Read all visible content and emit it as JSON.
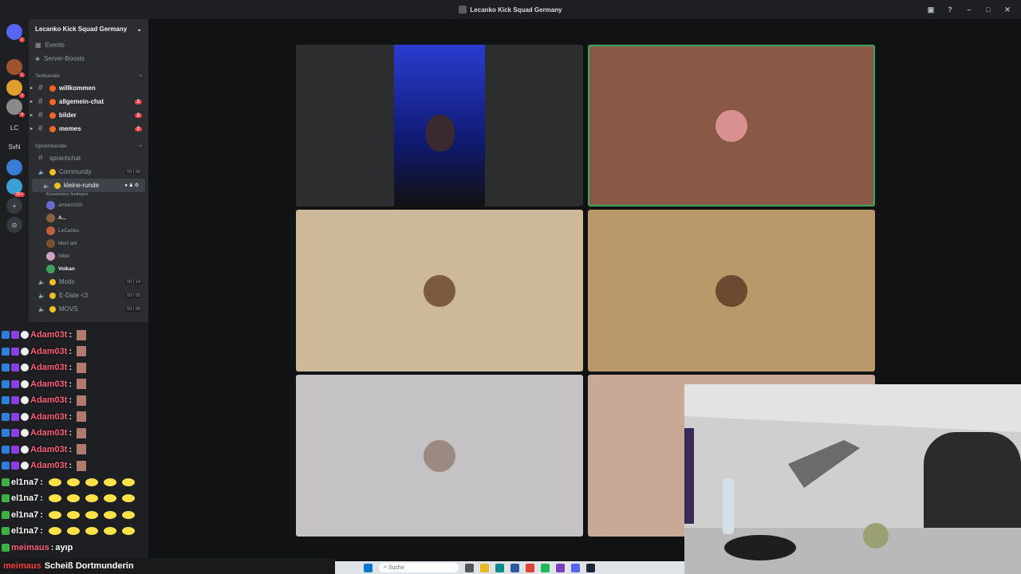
{
  "window": {
    "title": "Lecanko Kick Squad Germany"
  },
  "servers": [
    {
      "label": "",
      "badge": "2",
      "color": "#5865f2"
    },
    {
      "label": "",
      "badge": "1",
      "color": "#a0522d"
    },
    {
      "label": "",
      "badge": "2",
      "color": "#e0a030"
    },
    {
      "label": "",
      "badge": "4",
      "color": "#8a8a8a"
    },
    {
      "label": "LC",
      "badge": "",
      "color": "#1e1f22"
    },
    {
      "label": "SvN",
      "badge": "",
      "color": "#1e1f22"
    },
    {
      "label": "",
      "badge": "",
      "color": "#3a7bd5"
    },
    {
      "label": "",
      "badge": "2K+",
      "color": "#3aa0d5"
    }
  ],
  "sidebar": {
    "guild_name": "Lecanko Kick Squad Germany",
    "events": "Events",
    "boosts": "Server-Boosts",
    "text_category": "Textkanäle",
    "text_channels": [
      {
        "name": "willkommen",
        "badge": "",
        "dot": "#f26522"
      },
      {
        "name": "allgemein-chat",
        "badge": "2",
        "dot": "#f26522"
      },
      {
        "name": "bilder",
        "badge": "2",
        "dot": "#f26522"
      },
      {
        "name": "memes",
        "badge": "2",
        "dot": "#f26522"
      }
    ],
    "voice_category": "Sprachkanäle",
    "voice_channels": [
      {
        "name": "sprachchat",
        "pill": ""
      },
      {
        "name": "Community",
        "pill": "00 | 99"
      },
      {
        "name": "kleine-runde",
        "pill": ""
      }
    ],
    "status_text": "Kanalstatus festlegen",
    "voice_users": [
      {
        "name": "amiem030",
        "color": "#6a6ad0"
      },
      {
        "name": "A...",
        "color": "#8a6040"
      },
      {
        "name": "LeCanko",
        "color": "#c06040"
      },
      {
        "name": "Mert abi",
        "color": "#7a5030"
      },
      {
        "name": "Nikki",
        "color": "#d0a0c0"
      },
      {
        "name": "Volkan",
        "color": "#40a060"
      }
    ],
    "more_voice": [
      {
        "name": "Mods",
        "pill": "00 | 14"
      },
      {
        "name": "E-Date <3",
        "pill": "00 | 05"
      },
      {
        "name": "MOVS",
        "pill": "00 | 99"
      }
    ]
  },
  "tiles": [
    {
      "id": "video-stream",
      "bg": "#2b2d2e",
      "face": ""
    },
    {
      "id": "user-2",
      "bg": "#8a5847",
      "face": "#d89090"
    },
    {
      "id": "user-3",
      "bg": "#cdb999",
      "face": "#7a5a40"
    },
    {
      "id": "user-4",
      "bg": "#b9996a",
      "face": "#6a4a30"
    },
    {
      "id": "user-5",
      "bg": "#c5c2c5",
      "face": "#9a8a80"
    },
    {
      "id": "user-6",
      "bg": "#c8a896",
      "face": ""
    }
  ],
  "chat": [
    {
      "user": "Adam03t",
      "kind": "picture"
    },
    {
      "user": "Adam03t",
      "kind": "picture"
    },
    {
      "user": "Adam03t",
      "kind": "picture"
    },
    {
      "user": "Adam03t",
      "kind": "picture"
    },
    {
      "user": "Adam03t",
      "kind": "picture"
    },
    {
      "user": "Adam03t",
      "kind": "picture"
    },
    {
      "user": "Adam03t",
      "kind": "picture"
    },
    {
      "user": "Adam03t",
      "kind": "picture"
    },
    {
      "user": "Adam03t",
      "kind": "picture"
    },
    {
      "user": "el1na7",
      "kind": "emotes"
    },
    {
      "user": "el1na7",
      "kind": "emotes"
    },
    {
      "user": "el1na7",
      "kind": "emotes"
    },
    {
      "user": "el1na7",
      "kind": "emotes"
    },
    {
      "user": "meimaus",
      "kind": "text",
      "text": "ayıp"
    }
  ],
  "ticker": {
    "user": "meimaus",
    "message": "Scheiß Dortmunderin"
  },
  "taskbar": {
    "search_placeholder": "Suche"
  },
  "colors": {
    "bg": "#1e1f22",
    "sidebar": "#2b2d31",
    "speaking": "#3ba55c",
    "mention": "#f23f43"
  }
}
